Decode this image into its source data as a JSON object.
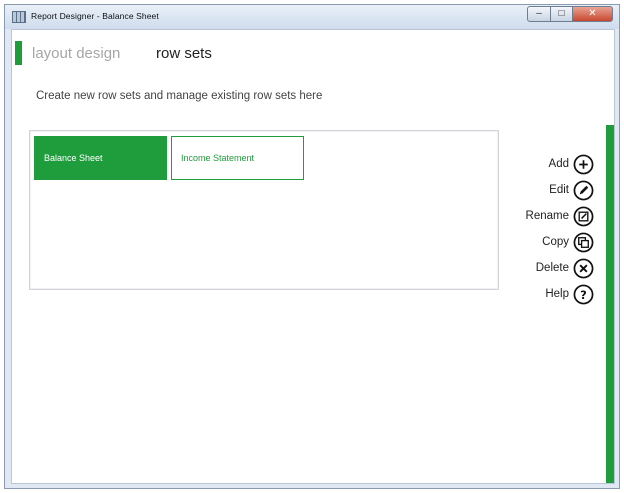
{
  "window": {
    "title": "Report Designer - Balance Sheet",
    "controls": {
      "minimize": "–",
      "maximize": "□",
      "close": "✕"
    }
  },
  "tabs": [
    {
      "label": "layout design",
      "active": false
    },
    {
      "label": "row sets",
      "active": true
    }
  ],
  "subtitle": "Create new row sets and manage existing row sets here",
  "row_sets": [
    {
      "label": "Balance Sheet",
      "selected": true
    },
    {
      "label": "Income Statement",
      "selected": false
    }
  ],
  "actions": [
    {
      "label": "Add",
      "icon": "plus-circle-icon"
    },
    {
      "label": "Edit",
      "icon": "pencil-circle-icon"
    },
    {
      "label": "Rename",
      "icon": "rename-circle-icon"
    },
    {
      "label": "Copy",
      "icon": "copy-circle-icon"
    },
    {
      "label": "Delete",
      "icon": "x-circle-icon"
    },
    {
      "label": "Help",
      "icon": "question-circle-icon"
    }
  ],
  "colors": {
    "accent": "#1f9d3c"
  }
}
